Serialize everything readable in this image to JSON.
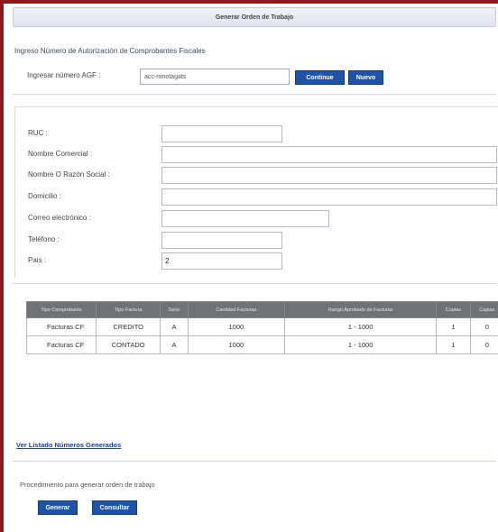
{
  "header": {
    "title": "Generar Orden de Trabajo"
  },
  "afc": {
    "section_label": "Ingreso Número de Autorización de Comprobantes Fiscales",
    "field_label": "Ingresar número AGF :",
    "field_value": "acc-ronotagats",
    "continue_label": "Continue",
    "new_label": "Nuevo"
  },
  "form": {
    "fields": [
      {
        "label": "RUC :",
        "value": ""
      },
      {
        "label": "Nombre Comercial :",
        "value": ""
      },
      {
        "label": "Nombre O Razón Social :",
        "value": ""
      },
      {
        "label": "Domicilio :",
        "value": ""
      },
      {
        "label": "Correo electrónico :",
        "value": ""
      },
      {
        "label": "Teléfono :",
        "value": ""
      },
      {
        "label": "Pais :",
        "value": "2"
      }
    ]
  },
  "table": {
    "headers": [
      "Tipo Comprobante",
      "Tipo Factura",
      "Serie",
      "Cantidad Facturas",
      "Rango Aprobado de Facturas",
      "Copias",
      "Copias"
    ],
    "rows": [
      [
        "Facturas CF",
        "CREDITO",
        "A",
        "1000",
        "1 - 1000",
        "1",
        "0"
      ],
      [
        "Facturas CF",
        "CONTADO",
        "A",
        "1000",
        "1 - 1000",
        "1",
        "0"
      ]
    ]
  },
  "footer": {
    "link_label": "Ver Listado Números Generados",
    "procedure_label": "Procedimiento para generar orden de trabajo",
    "generate_label": "Generar",
    "consult_label": "Consultar"
  }
}
